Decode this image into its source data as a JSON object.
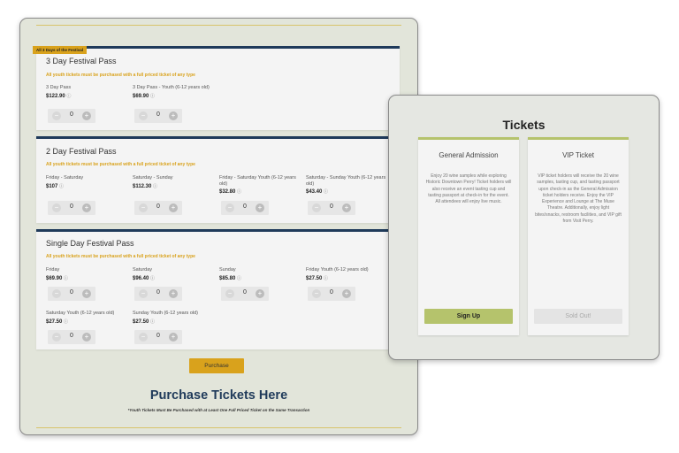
{
  "festival": {
    "ribbon": "All 3 Days of the Festival",
    "purchase_label": "Purchase",
    "headline": "Purchase Tickets Here",
    "fine_print": "*Youth Tickets Must Be Purchased with at Least One Full Priced Ticket on the Same Transaction",
    "sections": [
      {
        "title": "3 Day Festival Pass",
        "note": "All youth tickets must be purchased with a full priced ticket of any type",
        "tickets": [
          {
            "name": "3 Day Pass",
            "price": "$122.90",
            "qty": "0"
          },
          {
            "name": "3 Day Pass - Youth (6-12 years old)",
            "price": "$69.90",
            "qty": "0"
          }
        ]
      },
      {
        "title": "2 Day Festival Pass",
        "note": "All youth tickets must be purchased with a full priced ticket of any type",
        "tickets": [
          {
            "name": "Friday - Saturday",
            "price": "$107",
            "qty": "0"
          },
          {
            "name": "Saturday - Sunday",
            "price": "$112.30",
            "qty": "0"
          },
          {
            "name": "Friday - Saturday Youth (6-12 years old)",
            "price": "$32.80",
            "qty": "0"
          },
          {
            "name": "Saturday - Sunday Youth (6-12 years old)",
            "price": "$43.40",
            "qty": "0"
          }
        ]
      },
      {
        "title": "Single Day Festival Pass",
        "note": "All youth tickets must be purchased with a full priced ticket of any type",
        "tickets": [
          {
            "name": "Friday",
            "price": "$69.90",
            "qty": "0"
          },
          {
            "name": "Saturday",
            "price": "$96.40",
            "qty": "0"
          },
          {
            "name": "Sunday",
            "price": "$85.80",
            "qty": "0"
          },
          {
            "name": "Friday Youth (6-12 years old)",
            "price": "$27.50",
            "qty": "0"
          },
          {
            "name": "Saturday Youth (6-12 years old)",
            "price": "$27.50",
            "qty": "0"
          },
          {
            "name": "Sunday Youth (6-12 years old)",
            "price": "$27.50",
            "qty": "0"
          }
        ]
      }
    ]
  },
  "tickets_panel": {
    "title": "Tickets",
    "cards": [
      {
        "title": "General Admission",
        "description": "Enjoy 20 wine samples while exploring Historic Downtown Perry! Ticket holders will also receive an event tasting cup and tasting passport at check-in for the event. All attendees will enjoy live music.",
        "button": "Sign Up"
      },
      {
        "title": "VIP Ticket",
        "description": "VIP ticket holders will receive the 20 wine samples, tasting cup, and tasting passport upon check-in as the General Admission ticket holders receive. Enjoy the VIP Experience and Lounge at The Muse Theatre. Additionally, enjoy light bites/snacks, restroom facilities, and VIP gift from Visit Perry.",
        "button": "Sold Out!"
      }
    ]
  },
  "icons": {
    "info": "info-circle-icon",
    "minus": "minus-icon",
    "plus": "plus-icon"
  },
  "colors": {
    "navy": "#1f3a5a",
    "gold": "#d9a21c",
    "green": "#b5c36c"
  }
}
